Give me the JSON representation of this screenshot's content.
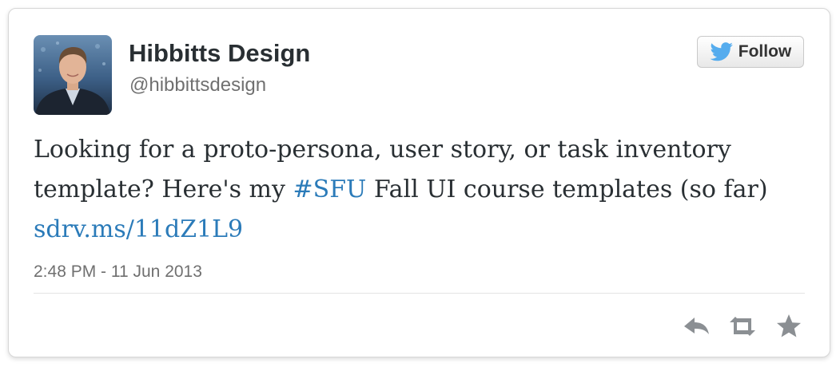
{
  "tweet": {
    "author": {
      "name": "Hibbitts Design",
      "handle": "@hibbittsdesign"
    },
    "follow_label": "Follow",
    "text": {
      "part1": "Looking for a proto-persona, user story, or task inventory template? Here's my ",
      "hashtag": "#SFU",
      "part2": " Fall UI course templates (so far) ",
      "link": "sdrv.ms/11dZ1L9"
    },
    "timestamp": "2:48 PM - 11 Jun 2013",
    "actions": {
      "reply_icon": "reply-icon",
      "retweet_icon": "retweet-icon",
      "favorite_icon": "favorite-star-icon"
    }
  },
  "colors": {
    "link": "#2b7bb9",
    "twitter_bird": "#55acee",
    "text": "#292f33",
    "muted": "#707070",
    "icon_gray": "#8b8f93"
  }
}
